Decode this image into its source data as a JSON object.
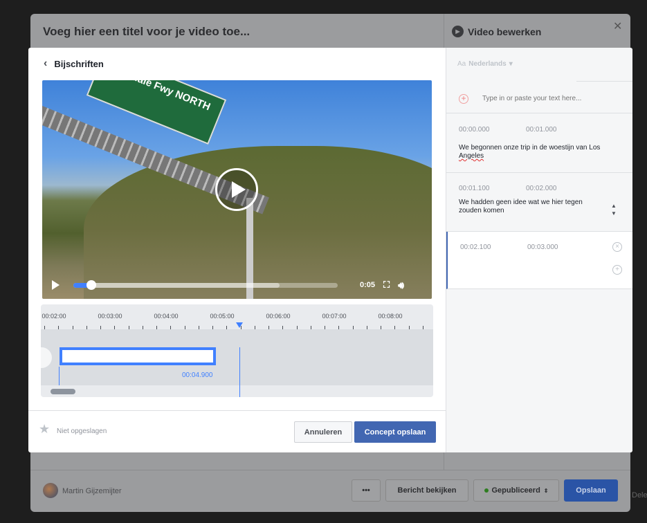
{
  "background": {
    "title": "Voeg hier een titel voor je video toe...",
    "panel_title": "Video bewerken",
    "user": "Martin Gijzemijter",
    "more": "•••",
    "view_post": "Bericht bekijken",
    "status": "Gepubliceerd",
    "status_arrow": "⇕",
    "save": "Opslaan",
    "edge_text": "Delen"
  },
  "modal": {
    "title": "Bijschriften",
    "sign_text": "Glendale Fwy NORTH",
    "video": {
      "time": "0:05",
      "progress_percent": 6,
      "buffered_percent": 78
    },
    "timeline": {
      "labels": [
        "00:02:00",
        "00:03:00",
        "00:04:00",
        "00:05:00",
        "00:06:00",
        "00:07:00",
        "00:08:00"
      ],
      "segment_end": "00:04.900"
    },
    "footer": {
      "status": "Niet opgeslagen",
      "cancel": "Annuleren",
      "save_draft": "Concept opslaan"
    }
  },
  "panel": {
    "aa": "Aa",
    "language": "Nederlands",
    "input_placeholder": "Type in or paste your text here...",
    "captions": [
      {
        "start": "00:00.000",
        "end": "00:01.000",
        "text_a": "We begonnen onze trip in de woestijn van Los",
        "text_b": "Angeles"
      },
      {
        "start": "00:01.100",
        "end": "00:02.000",
        "text_a": "We hadden geen idee wat we hier tegen",
        "text_b": "zouden komen"
      },
      {
        "start": "00:02.100",
        "end": "00:03.000"
      }
    ]
  }
}
